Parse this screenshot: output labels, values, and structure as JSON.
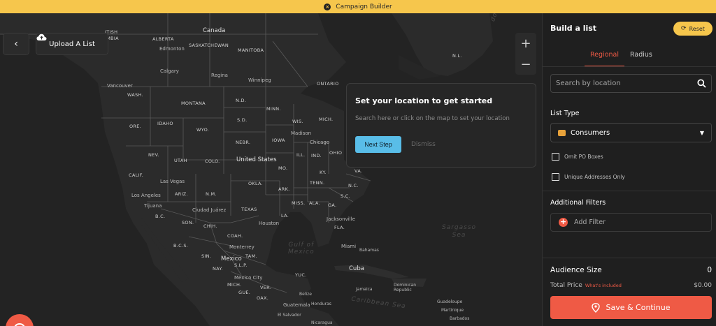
{
  "banner": {
    "title": "Campaign Builder"
  },
  "map": {
    "upload_label": "Upload A List",
    "zoom_in": "+",
    "zoom_out": "−",
    "attribution": "box",
    "labels": {
      "canada": "Canada",
      "alberta": "ALBERTA",
      "saskatchewan": "SASKATCHEWAN",
      "manitoba": "MANITOBA",
      "british_columbia": "ITISH\nIMBIA",
      "ontario": "ONTARIO",
      "nl": "N.L.",
      "edmonton": "Edmonton",
      "calgary": "Calgary",
      "regina": "Regina",
      "winnipeg": "Winnipeg",
      "vancouver": "Vancouver",
      "wash": "WASH.",
      "montana": "MONTANA",
      "nd": "N.D.",
      "minn": "MINN.",
      "ore": "ORE.",
      "idaho": "IDAHO",
      "wyo": "WYO.",
      "sd": "S.D.",
      "wis": "WIS.",
      "mich": "MICH.",
      "madison": "Madison",
      "chicago": "Chicago",
      "nev": "NEV.",
      "utah": "UTAH",
      "colo": "COLO.",
      "nebr": "NEBR.",
      "iowa": "IOWA",
      "ill": "ILL.",
      "ind": "IND.",
      "ohio": "OHIO",
      "calif": "CALIF.",
      "united_states": "United States",
      "mo": "MO.",
      "ky": "KY.",
      "va": "VA.",
      "las_vegas": "Las Vegas",
      "ariz": "ARIZ.",
      "nm": "N.M.",
      "okla": "OKLA.",
      "ark": "ARK.",
      "tenn": "TENN.",
      "nc": "N.C.",
      "los_angeles": "Los Angeles",
      "tijuana": "Tijuana",
      "texas": "TEXAS",
      "miss": "MISS.",
      "ala": "ALA.",
      "ga": "GA.",
      "sc": "S.C.",
      "ciudad_juarez": "Ciudad Juárez",
      "bc_mx": "B.C.",
      "son": "SON.",
      "chih": "CHIH.",
      "houston": "Houston",
      "la": "LA.",
      "jacksonville": "Jacksonville",
      "fla": "FLA.",
      "coah": "COAH.",
      "bcs": "B.C.S.",
      "monterrey": "Monterrey",
      "miami": "Miami",
      "bahamas": "Bahamas",
      "gulf": "Gulf of\nMexico",
      "sargasso": "Sargasso\nSea",
      "sin": "SIN.",
      "tam": "TAM.",
      "nay": "NAY.",
      "slp": "S.L.P.",
      "mexico": "Mexico",
      "cuba": "Cuba",
      "yuc": "YUC.",
      "mich_mx": "MICH.",
      "gue": "GUE.",
      "ver": "VER.",
      "mexico_city": "Mexico City",
      "oax": "OAX.",
      "belize": "Belize",
      "jamaica": "Jamaica",
      "dominican": "Dominican\nRepublic",
      "guatemala": "Guatemala",
      "honduras": "Honduras",
      "caribbean": "Caribbean Sea",
      "guadeloupe": "Guadeloupe",
      "martinique": "Martinique",
      "barbados": "Barbados",
      "el_salvador": "El Salvador",
      "nicaragua": "Nicaragua",
      "sea_fragment": "dor Sea"
    }
  },
  "popup": {
    "title": "Set your location to get started",
    "description": "Search here or click on the map to set your location",
    "next_label": "Next Step",
    "dismiss_label": "Dismiss"
  },
  "panel": {
    "title": "Build a list",
    "reset_label": "Reset",
    "tabs": [
      "Regional",
      "Radius"
    ],
    "search_placeholder": "Search by location",
    "list_type_label": "List Type",
    "list_type_value": "Consumers",
    "omit_po_label": "Omit PO Boxes",
    "unique_label": "Unique Addresses Only",
    "additional_filters_label": "Additional Filters",
    "add_filter_label": "Add Filter",
    "audience_size_label": "Audience Size",
    "audience_size_value": "0",
    "total_price_label": "Total Price",
    "whats_included": "What's included",
    "total_price_value": "$0.00",
    "save_label": "Save & Continue"
  },
  "colors": {
    "accent": "#ef5a45",
    "banner": "#f6c64c",
    "next_button": "#59bde8"
  }
}
